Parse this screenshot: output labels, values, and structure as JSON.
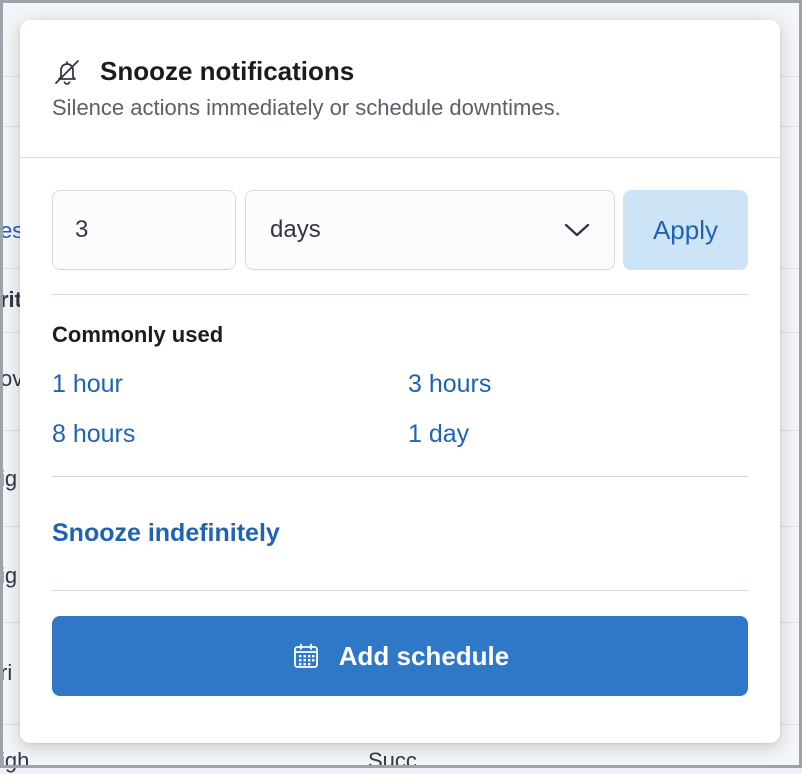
{
  "popover": {
    "title": "Snooze notifications",
    "subtitle": "Silence actions immediately or schedule downtimes.",
    "title_icon": "bell-slash-icon"
  },
  "snooze_form": {
    "duration_value": "3",
    "unit_selected": "days",
    "apply_label": "Apply"
  },
  "commonly_used": {
    "heading": "Commonly used",
    "options": [
      "1 hour",
      "3 hours",
      "8 hours",
      "1 day"
    ]
  },
  "snooze_indefinitely_label": "Snooze indefinitely",
  "add_schedule": {
    "label": "Add schedule",
    "icon": "calendar-icon"
  },
  "background_fragments": [
    "es",
    "rit",
    "ov",
    "ig",
    "ig",
    "ri",
    "igh",
    "Succ"
  ],
  "colors": {
    "link": "#1f63b5",
    "primary_button": "#2f78c8",
    "apply_button_bg": "#cce4f5",
    "border": "#d3dae6"
  }
}
